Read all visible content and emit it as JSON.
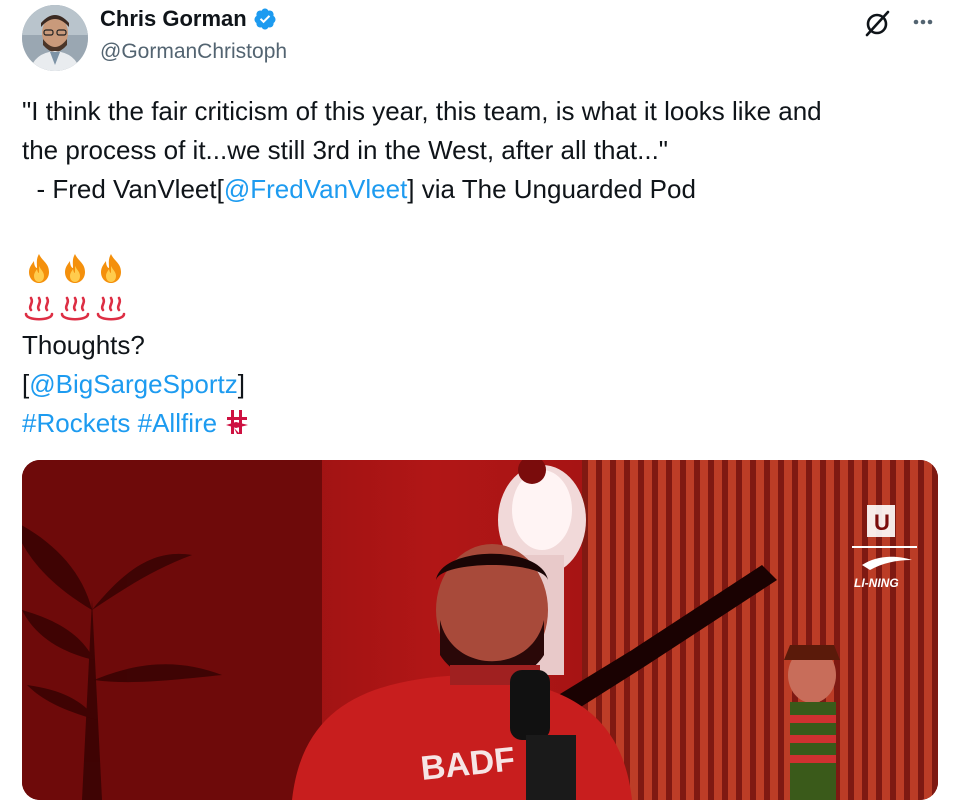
{
  "author": {
    "display_name": "Chris Gorman",
    "handle": "@GormanChristoph",
    "verified": true
  },
  "icons": {
    "verified": "verified-badge-icon",
    "grok": "grok-icon",
    "more": "more-options-icon",
    "fire": "fire-emoji",
    "hot_springs": "hot-springs-emoji",
    "rockets_logo": "houston-rockets-logo"
  },
  "colors": {
    "link": "#1d9bf0",
    "verified": "#1d9bf0",
    "text": "#0f1419",
    "secondary": "#536471"
  },
  "tweet": {
    "line1": "\"I think the fair criticism of this year, this team, is what it looks like and",
    "line2": "the process of it...we still 3rd in the West, after all that...\"",
    "line3_prefix": "  - Fred VanVleet[",
    "line3_mention": "@FredVanVleet",
    "line3_suffix": "] via The Unguarded Pod",
    "thoughts": "Thoughts?",
    "mention_open": "[",
    "mention": "@BigSargeSportz",
    "mention_close": "]",
    "hashtag1": "#Rockets",
    "hashtag2": "#Allfire"
  },
  "media": {
    "brand_letter": "U",
    "brand_name": "LI-NING",
    "shirt_text": "BADF"
  }
}
